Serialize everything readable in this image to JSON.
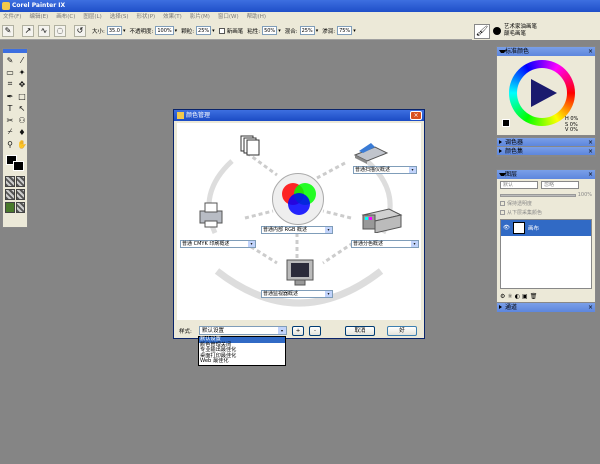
{
  "app": {
    "title": "Corel Painter IX"
  },
  "menu": [
    "文件(F)",
    "编辑(E)",
    "画布(C)",
    "图层(L)",
    "选择(S)",
    "形状(P)",
    "效果(T)",
    "影片(M)",
    "窗口(W)",
    "帮助(H)"
  ],
  "propbar": {
    "size_label": "大小:",
    "size_value": "35.0",
    "opacity_label": "不透明度:",
    "opacity_value": "100%",
    "grain_label": "颗粒:",
    "grain_value": "25%",
    "new_layer_label": "新画笔",
    "resat_label": "粘性:",
    "resat_value": "50%",
    "bleed_label": "混合:",
    "bleed_value": "25%",
    "jitter_label": "渗润:",
    "jitter_value": "75%"
  },
  "brush": {
    "category": "艺术家油画笔",
    "variant": "颠毛画笔"
  },
  "panels": {
    "color": {
      "title": "标准颜色",
      "h": "H",
      "s": "S",
      "v": "V",
      "h_val": "0%",
      "s_val": "0%",
      "v_val": "0%"
    },
    "mixer": {
      "title": "调色器"
    },
    "colorset": {
      "title": "颜色集"
    },
    "layers": {
      "title": "图层",
      "composite": "默认",
      "method": "忽略",
      "opacity": "100%",
      "preserve": "保持透明度",
      "pick": "从下层采集颜色",
      "item": "画布"
    },
    "channels": {
      "title": "通道"
    }
  },
  "dialog": {
    "title": "颜色管理",
    "devices": {
      "scanner": "普通扫描仪概述",
      "internal": "普通内部 RGB 概述",
      "printer": "普通 CMYK 印刷概述",
      "separation": "普通分色概述",
      "monitor": "普通监视器概述"
    },
    "style_label": "样式:",
    "style_value": "默认设置",
    "add": "+",
    "remove": "-",
    "cancel": "取消",
    "ok": "好",
    "style_options": [
      "默认设置",
      "颜色管理关闭",
      "专业输出最佳化",
      "桌面打印最佳化",
      "Web 最佳化"
    ]
  }
}
